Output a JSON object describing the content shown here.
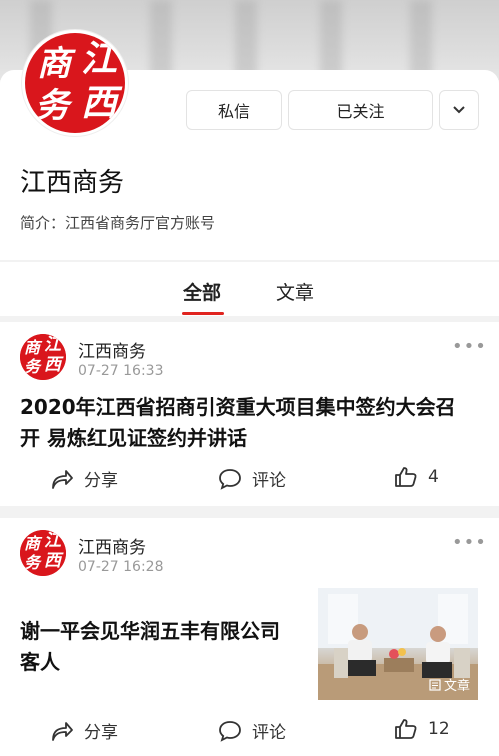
{
  "profile": {
    "seal_chars": [
      "商",
      "江",
      "务",
      "西"
    ],
    "name": "江西商务",
    "intro": "简介：江西省商务厅官方账号",
    "message_button": "私信",
    "follow_button": "已关注"
  },
  "tabs": [
    {
      "label": "全部",
      "active": true
    },
    {
      "label": "文章",
      "active": false
    }
  ],
  "posts": [
    {
      "author": "江西商务",
      "time": "07-27 16:33",
      "title_line1": "2020年江西省招商引资重大项目集中签约大会召",
      "title_line2": "开 易炼红见证签约并讲话",
      "share_label": "分享",
      "comment_label": "评论",
      "like_count": "4"
    },
    {
      "author": "江西商务",
      "time": "07-27 16:28",
      "title_line1": "谢一平会见华润五丰有限公司",
      "title_line2": "客人",
      "share_label": "分享",
      "comment_label": "评论",
      "like_count": "12",
      "thumb_tag": "文章"
    }
  ],
  "colors": {
    "accent": "#e0241f",
    "seal": "#d9161c"
  }
}
